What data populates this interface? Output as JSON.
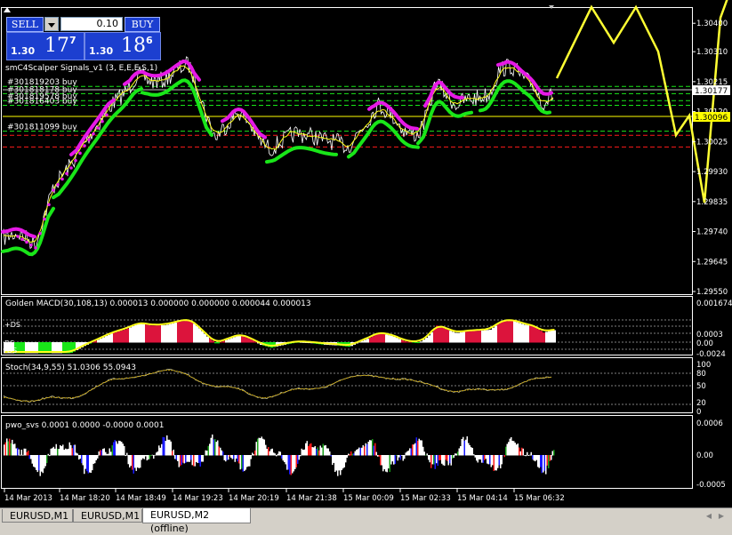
{
  "colors": {
    "background": "#000000",
    "grid_text": "#ffffff",
    "price_line": "#ffffff",
    "signal_green": "#19e619",
    "signal_magenta": "#e619e6",
    "ma_yellow": "#ffff19",
    "projection": "#ffff33",
    "macd_bar_up": "#dc143c",
    "macd_bar_dn": "#19e619",
    "macd_bar_neutral": "#ffffff",
    "order_buy_line": "#19e619",
    "order_sl_line": "#ff1a1a"
  },
  "trade_panel": {
    "sell_label": "SELL",
    "buy_label": "BUY",
    "lot_value": "0.10",
    "sell_price_prefix": "1.30",
    "sell_price_big": "17",
    "sell_price_sup": "7",
    "buy_price_prefix": "1.30",
    "buy_price_big": "18",
    "buy_price_sup": "6"
  },
  "main_chart": {
    "indicator_label": "smC4Scalper Signals_v1 (3, E,E,E,S,1)",
    "orders": [
      {
        "label": "#301819203 buy",
        "price": 1.302
      },
      {
        "label": "#301818178 buy",
        "price": 1.30177
      },
      {
        "label": "#301819578 buy",
        "price": 1.30155
      },
      {
        "label": "#301816403 buy",
        "price": 1.3014
      },
      {
        "label": "#301811099 buy",
        "price": 1.30058
      }
    ],
    "bid_label": "1.30177",
    "ask_label": "1.30096",
    "price_ticks": [
      "1.30400",
      "1.30310",
      "1.30215",
      "1.30120",
      "1.30025",
      "1.29930",
      "1.29835",
      "1.29740",
      "1.29645",
      "1.29550"
    ],
    "price_range": [
      1.2955,
      1.3044
    ]
  },
  "macd_panel": {
    "label": "Golden MACD(30,108,13) 0.000013 0.000000 0.000000 0.000044 0.000013",
    "axis_ticks": [
      "0.001674",
      "0.0003",
      "0.00",
      "-0.0024"
    ],
    "level_labels": [
      "+DS",
      "DS",
      "-DS"
    ]
  },
  "stoch_panel": {
    "label": "Stoch(34,9,55) 51.0306 55.0943",
    "axis_ticks": [
      "100",
      "80",
      "50",
      "20",
      "0"
    ]
  },
  "pwo_panel": {
    "label": "pwo_svs 0.0001 0.0000 -0.0000 0.0001",
    "axis_ticks": [
      "0.0006",
      "0.00",
      "-0.0005"
    ]
  },
  "time_axis": [
    "14 Mar 2013",
    "14 Mar 18:20",
    "14 Mar 18:49",
    "14 Mar 19:23",
    "14 Mar 20:19",
    "14 Mar 21:38",
    "15 Mar 00:09",
    "15 Mar 02:33",
    "15 Mar 04:14",
    "15 Mar 06:32"
  ],
  "tabs": [
    {
      "label": "EURUSD,M1",
      "active": false
    },
    {
      "label": "EURUSD,M1",
      "active": false
    },
    {
      "label": "EURUSD,M2 (offline)",
      "active": true
    }
  ],
  "tab_nav": {
    "prev": "◀",
    "next": "▶"
  }
}
